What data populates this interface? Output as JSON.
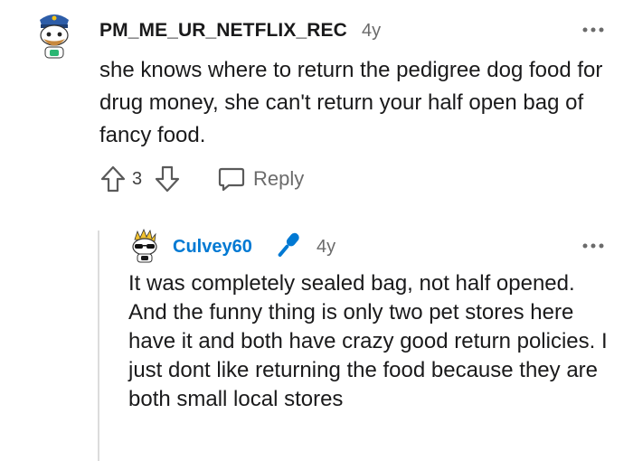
{
  "comment": {
    "username": "PM_ME_UR_NETFLIX_REC",
    "age": "4y",
    "text": "she knows where to return the pedigree dog food for drug money, she can't return your half open bag of fancy food.",
    "score": "3",
    "reply_label": "Reply",
    "avatar_icon": "snoo-police-avatar-icon",
    "more_icon": "more-options-icon"
  },
  "reply": {
    "username": "Culvey60",
    "username_color": "#0079d3",
    "age": "4y",
    "badge_icon": "microphone-icon",
    "avatar_icon": "snoo-sunglasses-avatar-icon",
    "more_icon": "more-options-icon",
    "text": "It was completely sealed bag, not half opened. And the funny thing is only two pet stores here have it and both have crazy good return policies. I just dont like returning the food because they are both small local stores"
  }
}
